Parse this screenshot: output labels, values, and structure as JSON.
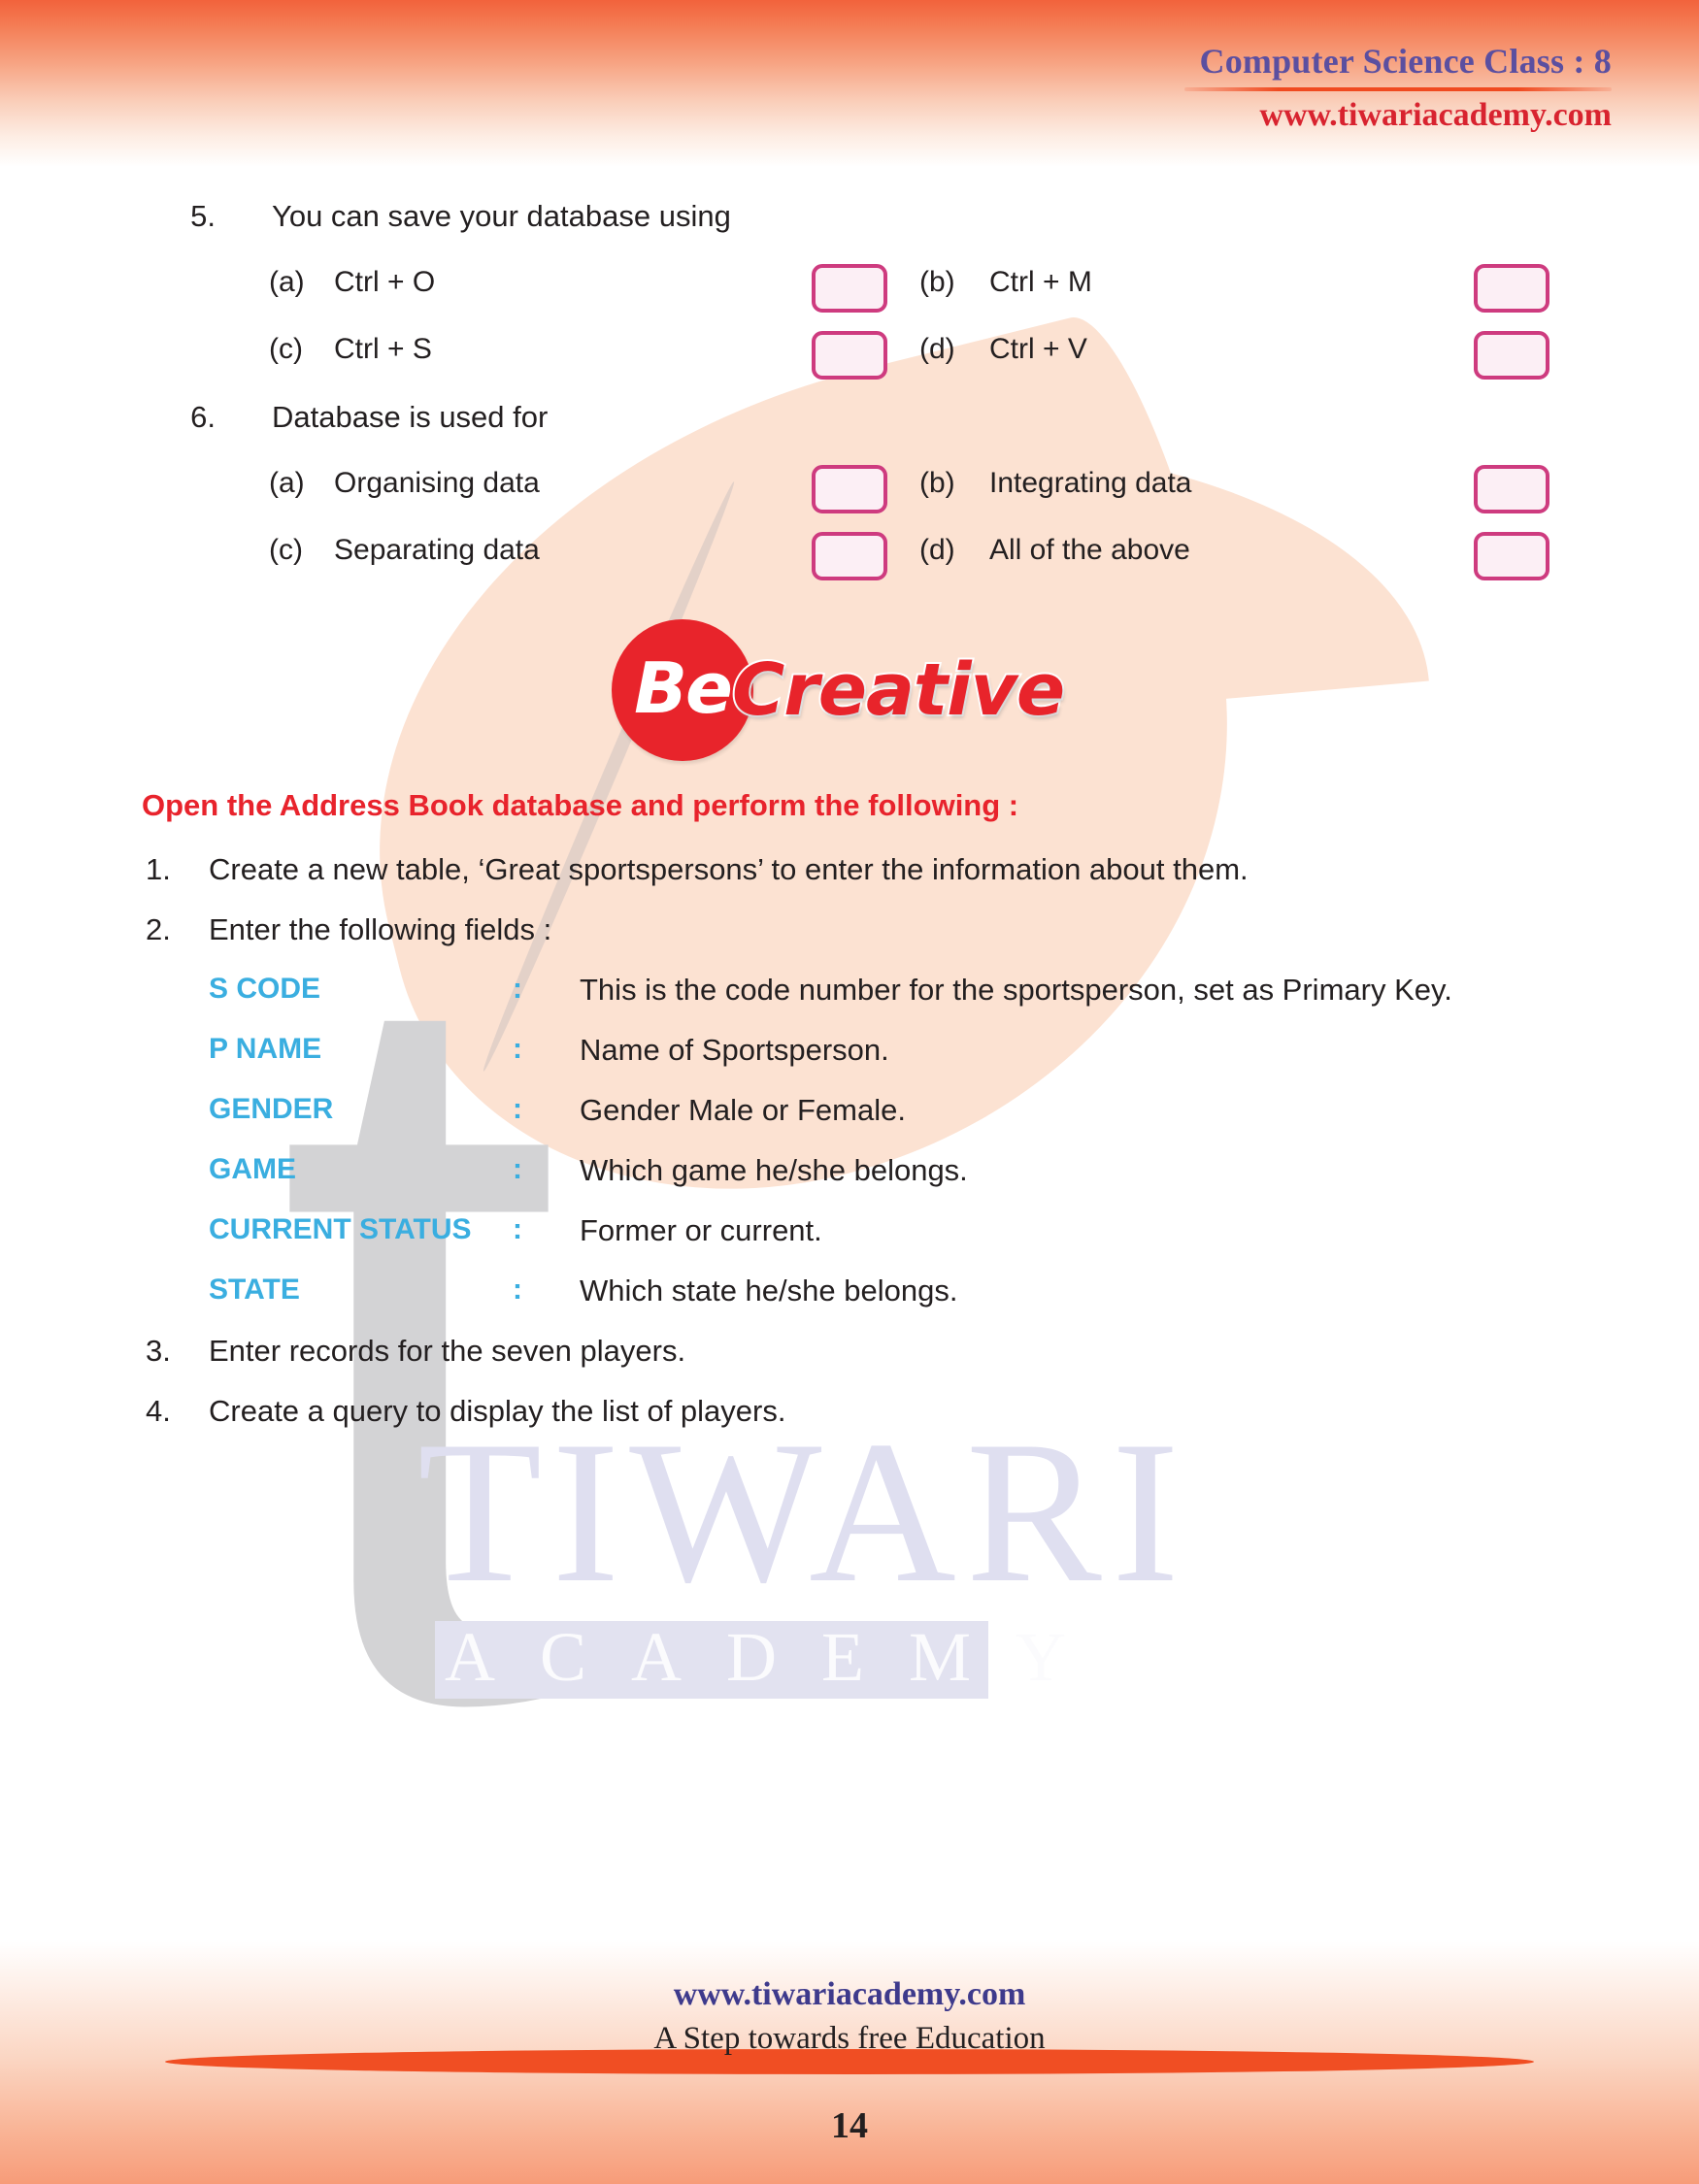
{
  "header": {
    "title": "Computer Science Class : 8",
    "site": "www.tiwariacademy.com"
  },
  "questions": [
    {
      "number": "5.",
      "text": "You can save your database using",
      "options": [
        {
          "label": "(a)",
          "text": "Ctrl + O"
        },
        {
          "label": "(b)",
          "text": "Ctrl + M"
        },
        {
          "label": "(c)",
          "text": "Ctrl + S"
        },
        {
          "label": "(d)",
          "text": "Ctrl + V"
        }
      ]
    },
    {
      "number": "6.",
      "text": "Database is used for",
      "options": [
        {
          "label": "(a)",
          "text": "Organising data"
        },
        {
          "label": "(b)",
          "text": "Integrating data"
        },
        {
          "label": "(c)",
          "text": "Separating data"
        },
        {
          "label": "(d)",
          "text": "All of the above"
        }
      ]
    }
  ],
  "logo": {
    "be": "Be",
    "creative": "Creative"
  },
  "activity": {
    "heading": "Open the Address Book database and perform the following :",
    "tasks": [
      {
        "number": "1.",
        "text": "Create a new table, ‘Great sportspersons’ to enter the information about them."
      },
      {
        "number": "2.",
        "text": "Enter the following fields :"
      },
      {
        "number": "3.",
        "text": "Enter records for the seven players."
      },
      {
        "number": "4.",
        "text": "Create a query to display the list of players."
      }
    ],
    "fields": [
      {
        "name": "S CODE",
        "colon": ":",
        "desc": "This is the code number for the sportsperson, set as Primary Key."
      },
      {
        "name": "P NAME",
        "colon": ":",
        "desc": "Name of Sportsperson."
      },
      {
        "name": "GENDER",
        "colon": ":",
        "desc": "Gender Male or Female."
      },
      {
        "name": "GAME",
        "colon": ":",
        "desc": "Which game he/she belongs."
      },
      {
        "name": "CURRENT STATUS",
        "colon": ":",
        "desc": "Former or current."
      },
      {
        "name": "STATE",
        "colon": ":",
        "desc": "Which state he/she belongs."
      }
    ]
  },
  "watermark": {
    "primary": "TIWARI",
    "secondary": "ACADEMY",
    "letterform": "t"
  },
  "footer": {
    "site": "www.tiwariacademy.com",
    "tagline": "A Step towards free Education",
    "page_number": "14"
  },
  "colors": {
    "accent_orange": "#F0502B",
    "header_purple": "#5B4FA0",
    "header_red": "#D8232F",
    "field_blue": "#3AAEE0",
    "box_border_pink": "#CE3B7F",
    "box_fill_pink": "#FCEFF5",
    "leaf_peach": "#FCE2D2",
    "watermark_lavender": "#DFDFF0"
  }
}
